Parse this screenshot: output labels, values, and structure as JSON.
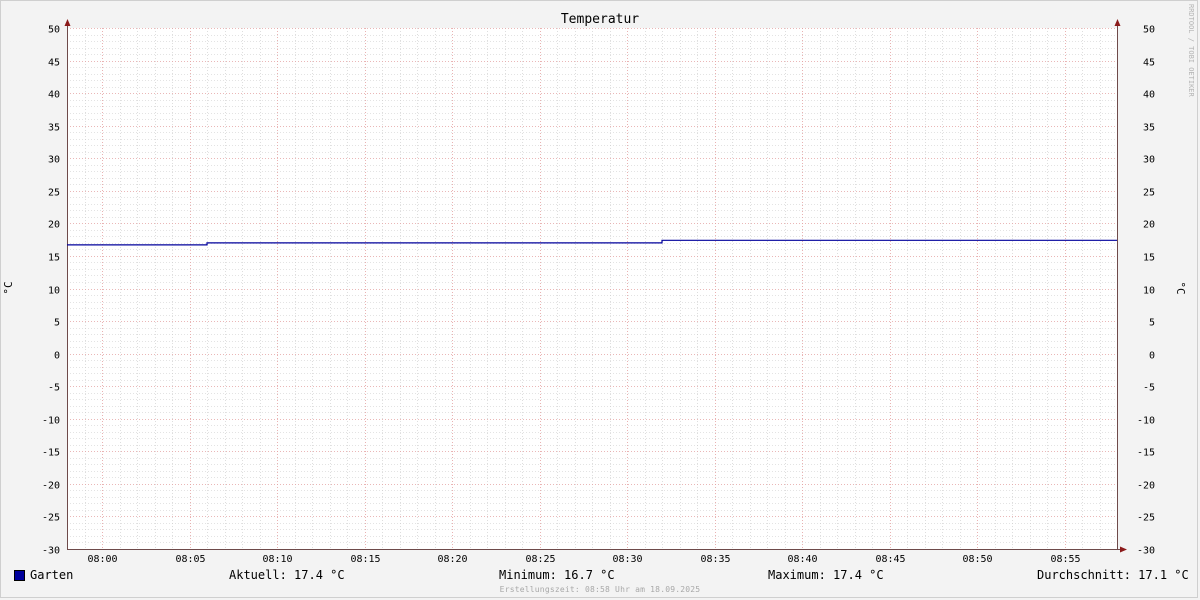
{
  "chart_data": {
    "type": "line",
    "title": "Temperatur",
    "ylabel": "°C",
    "ylabel_right": "°C",
    "ylim": [
      -30,
      50
    ],
    "y_ticks": [
      50,
      45,
      40,
      35,
      30,
      25,
      20,
      15,
      10,
      5,
      0,
      -5,
      -10,
      -15,
      -20,
      -25,
      -30
    ],
    "x_range": [
      "07:58",
      "08:58"
    ],
    "x_ticks": [
      "08:00",
      "08:05",
      "08:10",
      "08:15",
      "08:20",
      "08:25",
      "08:30",
      "08:35",
      "08:40",
      "08:45",
      "08:50",
      "08:55"
    ],
    "grid": true,
    "series": [
      {
        "name": "Garten",
        "color": "#00009c",
        "x": [
          "07:58",
          "08:06",
          "08:06",
          "08:32",
          "08:32",
          "08:58"
        ],
        "y": [
          16.7,
          16.7,
          17.0,
          17.0,
          17.4,
          17.4
        ]
      }
    ]
  },
  "legend": {
    "series_name": "Garten",
    "aktuell": "Aktuell: 17.4 °C",
    "minimum": "Minimum: 16.7 °C",
    "maximum": "Maximum: 17.4 °C",
    "durchschnitt": "Durchschnitt: 17.1 °C"
  },
  "footer": "Erstellungszeit: 08:58 Uhr am 18.09.2025",
  "watermark": "RRDTOOL / TOBI OETIKER",
  "colors": {
    "background": "#f3f3f3",
    "plot": "#ffffff",
    "series": "#00009c",
    "major_grid": "#e4a0a0",
    "minor_grid": "#c8c8c8",
    "axis": "#6e4a4a",
    "arrow": "#8b1a1a"
  }
}
